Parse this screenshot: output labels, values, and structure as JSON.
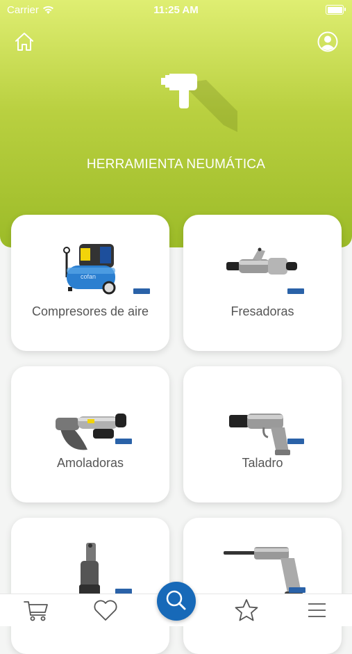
{
  "status_bar": {
    "carrier": "Carrier",
    "time": "11:25 AM"
  },
  "header": {
    "title": "HERRAMIENTA NEUMÁTICA",
    "icons": [
      "home-icon",
      "user-icon",
      "impact-wrench-icon"
    ]
  },
  "categories": [
    {
      "label": "Compresores  de  aire",
      "image": "air-compressor-image"
    },
    {
      "label": "Fresadoras",
      "image": "die-grinder-image"
    },
    {
      "label": "Amoladoras",
      "image": "angle-grinder-image"
    },
    {
      "label": "Taladro",
      "image": "air-drill-image"
    },
    {
      "label": "",
      "image": "rivet-gun-image"
    },
    {
      "label": "",
      "image": "air-hammer-image"
    }
  ],
  "bottom_nav": {
    "items": [
      "cart-icon",
      "heart-icon",
      "search-icon",
      "star-icon",
      "menu-icon"
    ]
  },
  "colors": {
    "header_gradient_top": "#dfee72",
    "header_gradient_bottom": "#9cbb28",
    "accent_blue": "#1769b8"
  }
}
